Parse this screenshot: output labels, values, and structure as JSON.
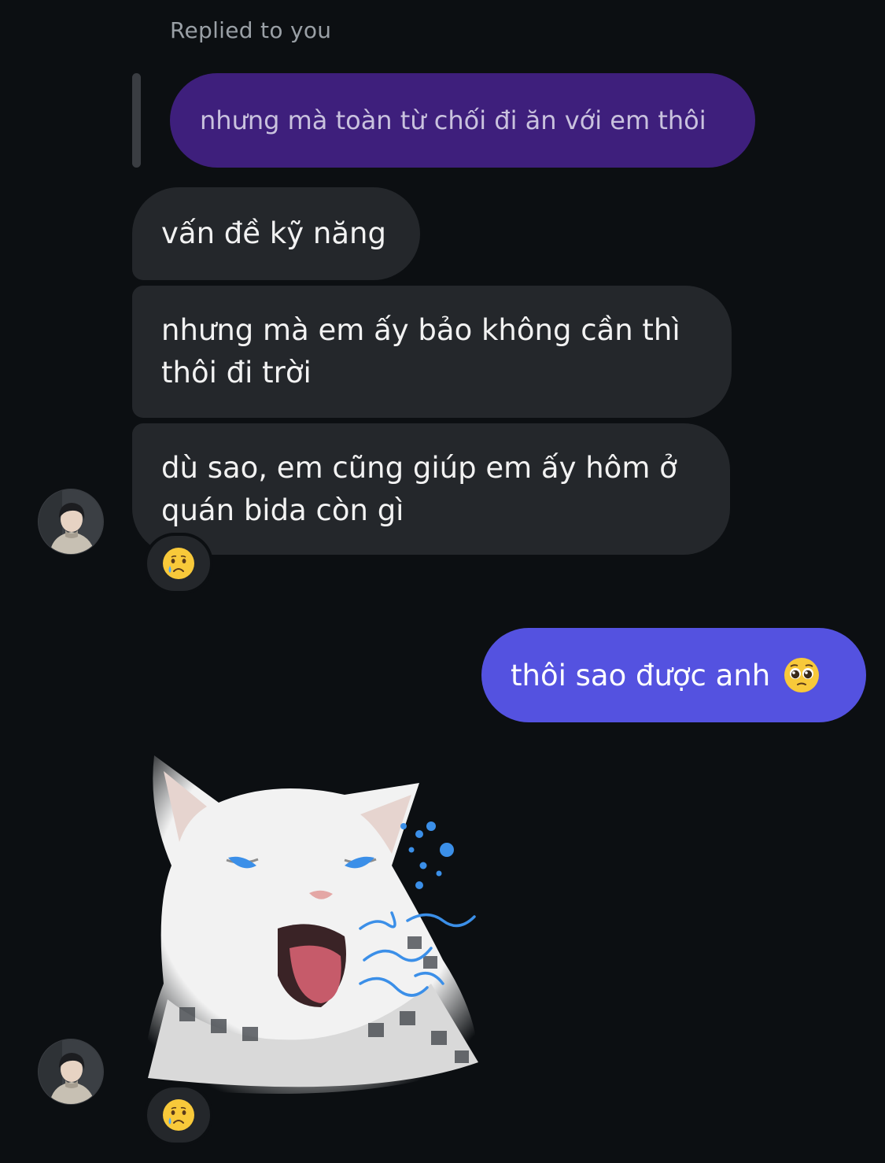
{
  "reply_context": {
    "label": "Replied to you",
    "quoted_message": "nhưng mà toàn từ chối đi ăn với em thôi"
  },
  "incoming_group_1": {
    "messages": [
      "vấn đề kỹ năng",
      "nhưng mà em ấy bảo không cần thì thôi đi trời",
      "dù sao, em cũng giúp em ấy hôm ở quán bida còn gì"
    ],
    "reaction_icon": "crying-face-icon"
  },
  "outgoing": {
    "text": "thôi sao được anh",
    "emoji_icon": "pleading-face-icon"
  },
  "incoming_group_2": {
    "sticker_icon": "crying-white-cat-sticker",
    "reaction_icon": "crying-face-icon"
  },
  "colors": {
    "background": "#0c0f12",
    "incoming_bubble": "#24272b",
    "quoted_bubble": "#3e1f7c",
    "outgoing_bubble": "#5452e0",
    "muted_text": "#9aa0a6"
  }
}
